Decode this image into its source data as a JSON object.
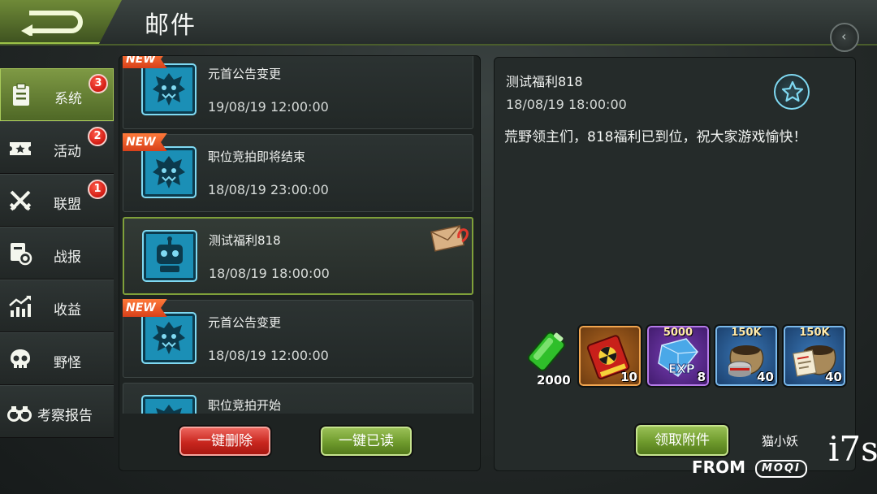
{
  "header": {
    "title": "邮件"
  },
  "sidebar": {
    "items": [
      {
        "label": "系统",
        "icon": "clipboard-icon",
        "badge": "3",
        "active": true
      },
      {
        "label": "活动",
        "icon": "ticket-icon",
        "badge": "2"
      },
      {
        "label": "联盟",
        "icon": "crossed-swords-icon",
        "badge": "1"
      },
      {
        "label": "战报",
        "icon": "report-medal-icon"
      },
      {
        "label": "收益",
        "icon": "growth-chart-icon"
      },
      {
        "label": "野怪",
        "icon": "skull-icon"
      },
      {
        "label": "考察报告",
        "icon": "binoculars-icon"
      }
    ]
  },
  "mail_list": {
    "items": [
      {
        "title": "元首公告变更",
        "date": "19/08/19  12:00:00",
        "new_tag": "NEW",
        "icon": "monster-icon"
      },
      {
        "title": "职位竞拍即将结束",
        "date": "18/08/19  23:00:00",
        "new_tag": "NEW",
        "icon": "monster-icon"
      },
      {
        "title": "测试福利818",
        "date": "18/08/19  18:00:00",
        "icon": "robot-icon",
        "attachment": true,
        "selected": true
      },
      {
        "title": "元首公告变更",
        "date": "18/08/19  12:00:00",
        "new_tag": "NEW",
        "icon": "monster-icon"
      },
      {
        "title": "职位竞拍开始",
        "icon": "monster-icon"
      }
    ],
    "delete_all_label": "一键删除",
    "read_all_label": "一键已读"
  },
  "detail": {
    "title": "测试福利818",
    "date": "18/08/19  18:00:00",
    "body": "荒野领主们，818福利已到位，祝大家游戏愉快！",
    "rewards": [
      {
        "icon": "battery-icon",
        "count": "2000"
      },
      {
        "icon": "nuclear-card-icon",
        "count": "10",
        "rarity": "orange"
      },
      {
        "icon": "exp-crystal-icon",
        "top": "5000",
        "count": "8",
        "rarity": "purple"
      },
      {
        "icon": "food-sack-icon",
        "top": "150K",
        "count": "40",
        "rarity": "blue"
      },
      {
        "icon": "supply-sack-icon",
        "top": "150K",
        "count": "40",
        "rarity": "blue"
      }
    ],
    "claim_label": "领取附件"
  },
  "watermark": {
    "name": "猫小妖",
    "from": "FROM",
    "brand": "MOQI",
    "site": "i7s"
  },
  "colors": {
    "accent_green": "#7fa03a",
    "badge_red": "#d11a12",
    "icon_cyan": "#1b8fb6",
    "new_orange": "#ff7a3a"
  }
}
